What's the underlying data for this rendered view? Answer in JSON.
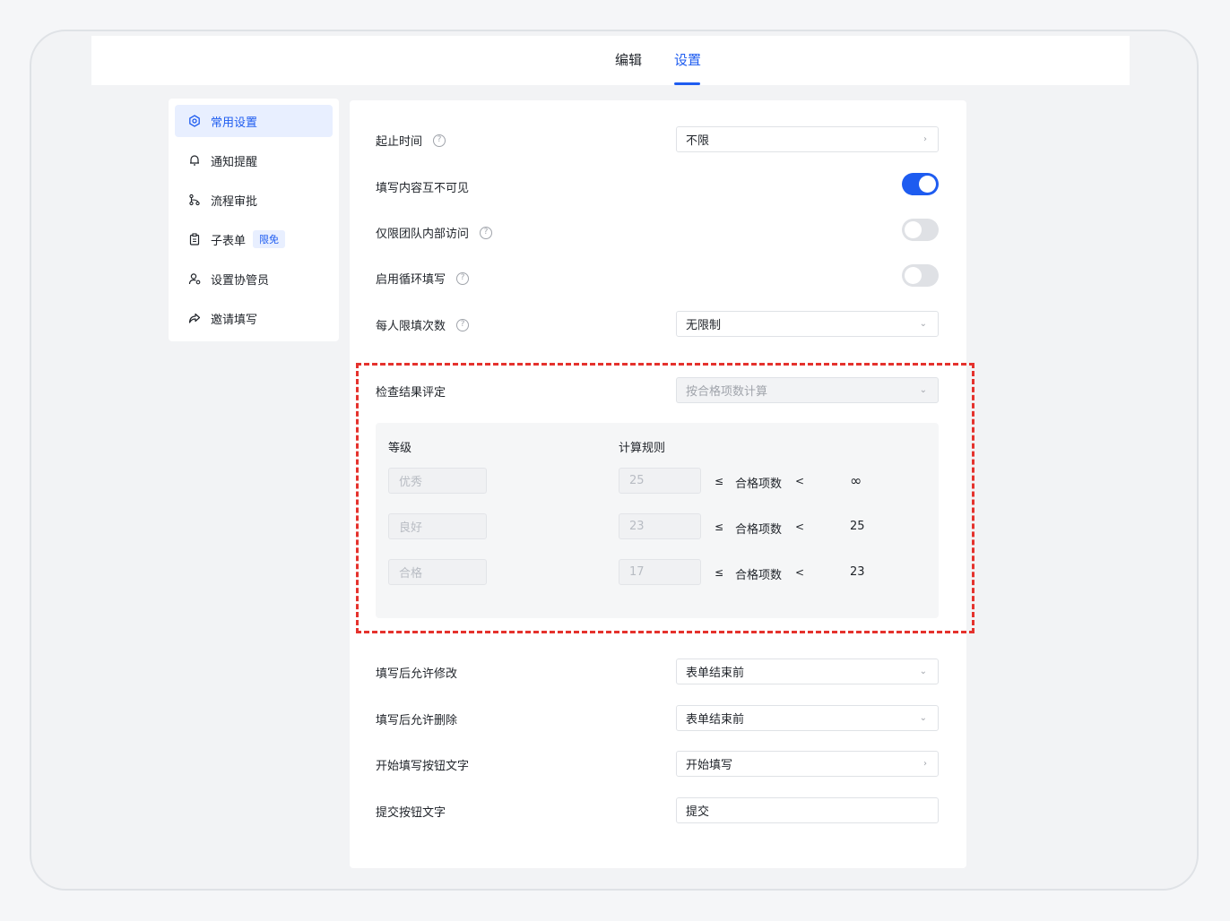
{
  "tabs": [
    {
      "label": "编辑",
      "active": false
    },
    {
      "label": "设置",
      "active": true
    }
  ],
  "sidebar": {
    "items": [
      {
        "label": "常用设置",
        "icon": "settings-hex-icon",
        "active": true
      },
      {
        "label": "通知提醒",
        "icon": "bell-icon"
      },
      {
        "label": "流程审批",
        "icon": "workflow-icon"
      },
      {
        "label": "子表单",
        "icon": "clipboard-icon",
        "badge": "限免"
      },
      {
        "label": "设置协管员",
        "icon": "user-gear-icon"
      },
      {
        "label": "邀请填写",
        "icon": "share-icon"
      }
    ]
  },
  "settings": {
    "start_end_time": {
      "label": "起止时间",
      "value": "不限"
    },
    "content_invisible": {
      "label": "填写内容互不可见",
      "enabled": true
    },
    "team_only": {
      "label": "仅限团队内部访问",
      "enabled": false
    },
    "loop_fill": {
      "label": "启用循环填写",
      "enabled": false
    },
    "limit_per_person": {
      "label": "每人限填次数",
      "value": "无限制"
    },
    "result_evaluation": {
      "label": "检查结果评定",
      "value": "按合格项数计算"
    },
    "allow_edit": {
      "label": "填写后允许修改",
      "value": "表单结束前"
    },
    "allow_delete": {
      "label": "填写后允许删除",
      "value": "表单结束前"
    },
    "start_button_text": {
      "label": "开始填写按钮文字",
      "value": "开始填写"
    },
    "submit_button_text": {
      "label": "提交按钮文字",
      "value": "提交"
    }
  },
  "grading": {
    "header_level": "等级",
    "header_rule": "计算规则",
    "le": "≤",
    "lt": "<",
    "metric": "合格项数",
    "rows": [
      {
        "level": "优秀",
        "min": "25",
        "max": "∞"
      },
      {
        "level": "良好",
        "min": "23",
        "max": "25"
      },
      {
        "level": "合格",
        "min": "17",
        "max": "23"
      }
    ]
  },
  "colors": {
    "accent": "#1e5cf0",
    "highlight_border": "#e5322d"
  }
}
